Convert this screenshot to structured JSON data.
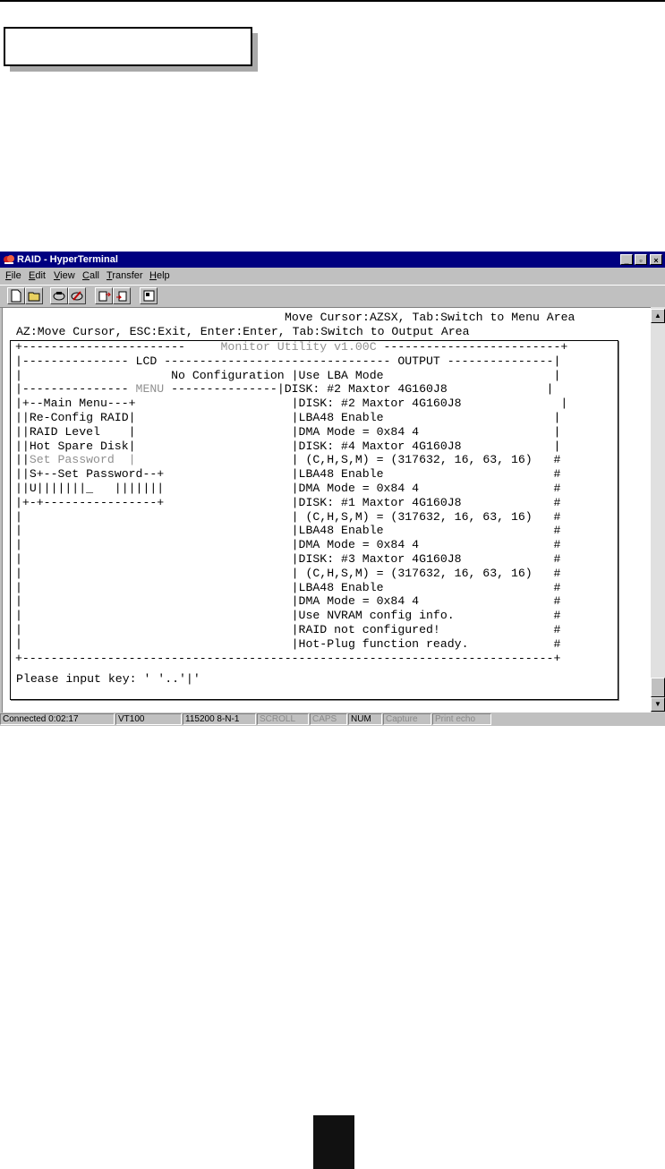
{
  "window": {
    "title": "RAID - HyperTerminal",
    "controls": [
      "_",
      "▫",
      "×"
    ]
  },
  "menu": [
    {
      "label": "File",
      "mnemonic": "F",
      "rest": "ile"
    },
    {
      "label": "Edit",
      "mnemonic": "E",
      "rest": "dit"
    },
    {
      "label": "View",
      "mnemonic": "V",
      "rest": "iew"
    },
    {
      "label": "Call",
      "mnemonic": "C",
      "rest": "all"
    },
    {
      "label": "Transfer",
      "mnemonic": "T",
      "rest": "ransfer"
    },
    {
      "label": "Help",
      "mnemonic": "H",
      "rest": "elp"
    }
  ],
  "toolbar": {
    "icons": [
      "new-document-icon",
      "open-folder-icon",
      "phone-connect-icon",
      "phone-disconnect-icon",
      "send-file-icon",
      "receive-file-icon",
      "properties-icon"
    ]
  },
  "terminal": {
    "header_right": "Move Cursor:AZSX, Tab:Switch to Menu Area",
    "header_left": "AZ:Move Cursor, ESC:Exit, Enter:Enter, Tab:Switch to Output Area",
    "lines": [
      {
        "a": "+-----------------------     ",
        "b": "Monitor Utility v1.00C",
        "c": " -------------------------+"
      },
      {
        "a": "|--------------- LCD -------------------------------- OUTPUT ---------------|",
        "b": "",
        "c": ""
      },
      {
        "a": "|                     No Configuration |Use LBA Mode                        |",
        "b": "",
        "c": ""
      },
      {
        "a": "|--------------- ",
        "b": "MENU",
        "c": " ---------------|DISK: #2 Maxtor 4G160J8              |"
      },
      {
        "a": "|+--Main Menu---+                      |DISK: #2 Maxtor 4G160J8              |",
        "b": "",
        "c": ""
      },
      {
        "a": "||Re-Config RAID|                      |LBA48 Enable                        |",
        "b": "",
        "c": ""
      },
      {
        "a": "||RAID Level    |                      |DMA Mode = 0x84 4                   |",
        "b": "",
        "c": ""
      },
      {
        "a": "||Hot Spare Disk|                      |DISK: #4 Maxtor 4G160J8             |",
        "b": "",
        "c": ""
      },
      {
        "a": "||",
        "b": "Set Password  |",
        "c": "                      | (C,H,S,M) = (317632, 16, 63, 16)   #"
      },
      {
        "a": "||S+--Set Password--+                  |LBA48 Enable                        #",
        "b": "",
        "c": ""
      },
      {
        "a": "||U|||||||_   |||||||                  |DMA Mode = 0x84 4                   #",
        "b": "",
        "c": ""
      },
      {
        "a": "|+-+----------------+                  |DISK: #1 Maxtor 4G160J8             #",
        "b": "",
        "c": ""
      },
      {
        "a": "|                                      | (C,H,S,M) = (317632, 16, 63, 16)   #",
        "b": "",
        "c": ""
      },
      {
        "a": "|                                      |LBA48 Enable                        #",
        "b": "",
        "c": ""
      },
      {
        "a": "|                                      |DMA Mode = 0x84 4                   #",
        "b": "",
        "c": ""
      },
      {
        "a": "|                                      |DISK: #3 Maxtor 4G160J8             #",
        "b": "",
        "c": ""
      },
      {
        "a": "|                                      | (C,H,S,M) = (317632, 16, 63, 16)   #",
        "b": "",
        "c": ""
      },
      {
        "a": "|                                      |LBA48 Enable                        #",
        "b": "",
        "c": ""
      },
      {
        "a": "|                                      |DMA Mode = 0x84 4                   #",
        "b": "",
        "c": ""
      },
      {
        "a": "|                                      |Use NVRAM config info.              #",
        "b": "",
        "c": ""
      },
      {
        "a": "|                                      |RAID not configured!                #",
        "b": "",
        "c": ""
      },
      {
        "a": "|                                      |Hot-Plug function ready.            #",
        "b": "",
        "c": ""
      },
      {
        "a": "+---------------------------------------------------------------------------+",
        "b": "",
        "c": ""
      }
    ],
    "prompt": "Please input key: ' '..'|'"
  },
  "status": {
    "connected": "Connected 0:02:17",
    "emulation": "VT100",
    "port": "115200 8-N-1",
    "scroll": "SCROLL",
    "caps": "CAPS",
    "num": "NUM",
    "capture": "Capture",
    "printecho": "Print echo"
  }
}
